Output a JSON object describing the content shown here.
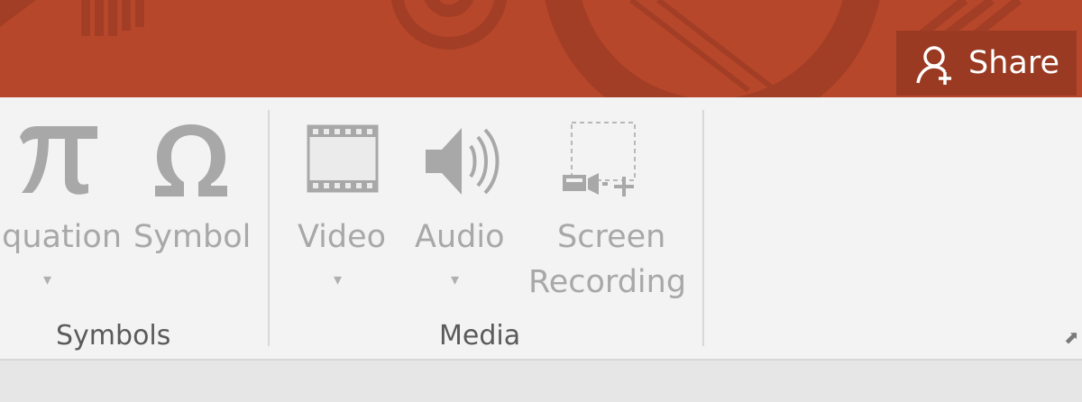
{
  "titlebar": {
    "accent_color": "#b7472a",
    "share": {
      "label": "Share",
      "icon": "person-add-icon"
    }
  },
  "ribbon": {
    "groups": [
      {
        "label": "Symbols",
        "commands": [
          {
            "label": "Equation",
            "icon": "pi-icon",
            "has_dropdown": true
          },
          {
            "label": "Symbol",
            "icon": "omega-icon",
            "has_dropdown": false
          }
        ]
      },
      {
        "label": "Media",
        "commands": [
          {
            "label": "Video",
            "icon": "film-icon",
            "has_dropdown": true
          },
          {
            "label": "Audio",
            "icon": "speaker-icon",
            "has_dropdown": true
          },
          {
            "label_line1": "Screen",
            "label_line2": "Recording",
            "icon": "screen-recording-icon",
            "has_dropdown": false
          }
        ]
      }
    ]
  }
}
